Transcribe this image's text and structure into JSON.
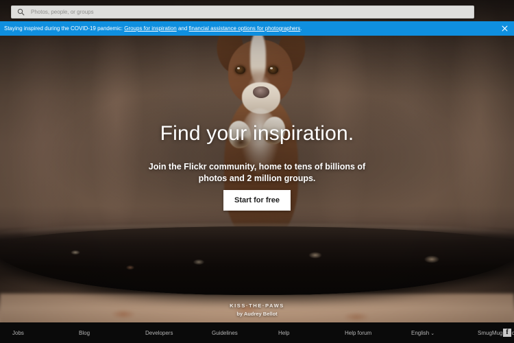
{
  "search": {
    "placeholder": "Photos, people, or groups",
    "value": "",
    "icon": "search-icon"
  },
  "banner": {
    "lead": "Staying inspired during the COVID-19 pandemic:",
    "link1": "Groups for inspiration",
    "conjunction": "and",
    "link2": "financial assistance options for photographers",
    "period": ".",
    "close_icon": "close-icon",
    "background_color": "#0f8fdf",
    "text_color": "#ffffff"
  },
  "hero": {
    "title": "Find your inspiration.",
    "subtitle": "Join the Flickr community, home to tens of billions of photos and 2 million groups.",
    "cta_label": "Start for free",
    "cta_background": "#ffffff",
    "cta_text_color": "#1c1c1c"
  },
  "credit": {
    "title": "KISS·THE·PAWS",
    "author": "by Audrey Bellot"
  },
  "footer": {
    "links": [
      {
        "label": "Jobs"
      },
      {
        "label": "Blog"
      },
      {
        "label": "Developers"
      },
      {
        "label": "Guidelines"
      },
      {
        "label": "Help"
      },
      {
        "label": "Help forum"
      },
      {
        "label": "English",
        "chevron": "⌄"
      },
      {
        "label": "SmugMug+Flickr"
      }
    ],
    "social_icon_label": "f",
    "background_color": "#0a0a0a",
    "text_color": "#b4b4b4"
  }
}
